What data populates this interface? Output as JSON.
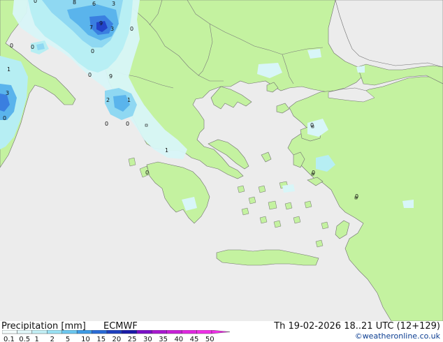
{
  "map": {
    "sea_color": "#ececec",
    "land_color": "#c4f2a0",
    "coast_color": "#6f6f6f",
    "border_color": "#7a7a7a",
    "precip_colors": [
      "#d8f6f8",
      "#b6eef3",
      "#8fd8f2",
      "#5ab4ec",
      "#3a7fe0",
      "#2243c8"
    ],
    "labels": [
      "0",
      "8",
      "6",
      "3",
      "7",
      "3",
      "9",
      "0",
      "0",
      "0",
      "0",
      "1",
      "3",
      "0",
      "0",
      "9",
      "2",
      "1",
      "0",
      "0",
      "1",
      "0",
      "0",
      "0",
      "0"
    ]
  },
  "title": {
    "left": "Precipitation [mm]",
    "model": "ECMWF",
    "date": "Th 19-02-2026 18..21 UTC (12+129)"
  },
  "credit": "©weatheronline.co.uk",
  "legend": {
    "ticks": [
      "0.1",
      "0.5",
      "1",
      "2",
      "5",
      "10",
      "15",
      "20",
      "25",
      "30",
      "35",
      "40",
      "45",
      "50"
    ],
    "colors": [
      "#f4fdfd",
      "#e2f8fa",
      "#c4f0f6",
      "#9ae2f4",
      "#6cc8f0",
      "#3e9ce6",
      "#2a6bd6",
      "#1e3fbe",
      "#1a1aa8",
      "#7a10c8",
      "#a818d0",
      "#c820d8",
      "#e028e0",
      "#f030e8"
    ]
  }
}
